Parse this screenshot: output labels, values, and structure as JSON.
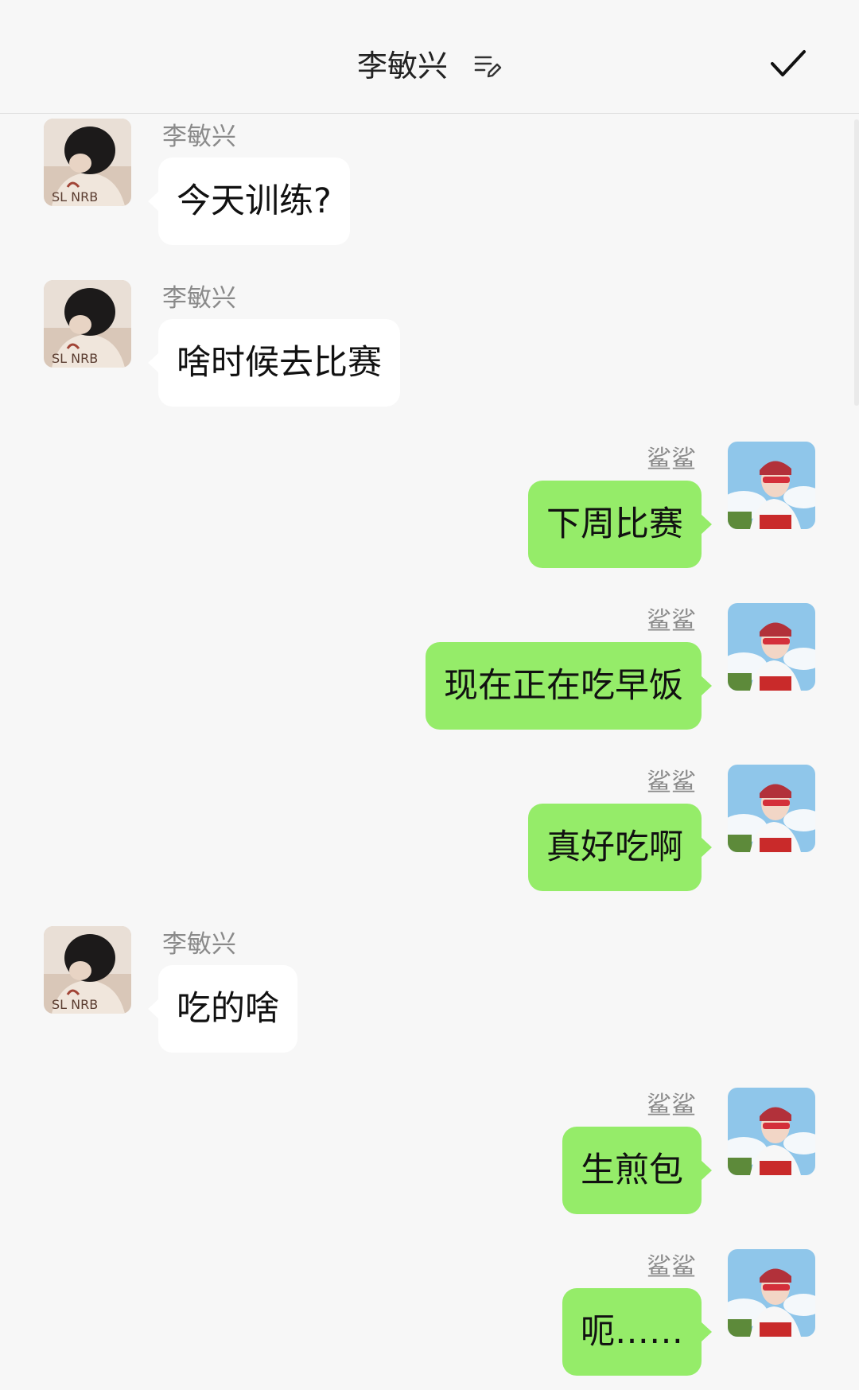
{
  "header": {
    "title": "李敏兴",
    "edit_icon": "list-edit-icon",
    "confirm_icon": "checkmark-icon"
  },
  "colors": {
    "background": "#f7f7f7",
    "incoming_bubble": "#ffffff",
    "outgoing_bubble": "#95ec69",
    "name_text": "#8a8a8a"
  },
  "messages": [
    {
      "side": "left",
      "sender": "李敏兴",
      "text": "今天训练?"
    },
    {
      "side": "left",
      "sender": "李敏兴",
      "text": "啥时候去比赛"
    },
    {
      "side": "right",
      "sender": "鲨鲨",
      "text": "下周比赛"
    },
    {
      "side": "right",
      "sender": "鲨鲨",
      "text": "现在正在吃早饭"
    },
    {
      "side": "right",
      "sender": "鲨鲨",
      "text": "真好吃啊"
    },
    {
      "side": "left",
      "sender": "李敏兴",
      "text": "吃的啥"
    },
    {
      "side": "right",
      "sender": "鲨鲨",
      "text": "生煎包"
    },
    {
      "side": "right",
      "sender": "鲨鲨",
      "text": "呃……"
    }
  ]
}
